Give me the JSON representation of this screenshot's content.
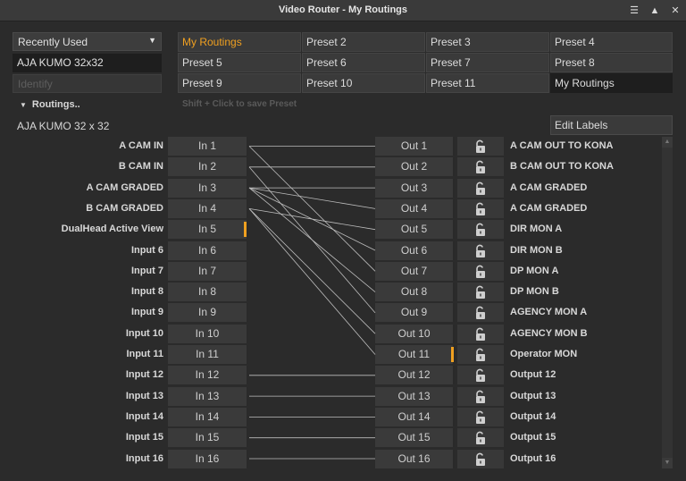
{
  "window": {
    "title": "Video Router - My Routings"
  },
  "recent": {
    "label": "Recently Used"
  },
  "device": {
    "name": "AJA KUMO 32x32"
  },
  "identify": {
    "label": "Identify"
  },
  "routings": {
    "toggle_label": "Routings..",
    "router_name": "AJA KUMO 32 x 32"
  },
  "presets": {
    "hint": "Shift + Click to save Preset",
    "rows": [
      [
        "My Routings",
        "Preset 2",
        "Preset 3",
        "Preset 4"
      ],
      [
        "Preset 5",
        "Preset 6",
        "Preset 7",
        "Preset 8"
      ],
      [
        "Preset 9",
        "Preset 10",
        "Preset 11",
        "My Routings"
      ]
    ],
    "active_color": "#f0a020"
  },
  "edit_labels": {
    "label": "Edit Labels"
  },
  "inputs": [
    {
      "label": "A CAM IN",
      "button": "In 1"
    },
    {
      "label": "B CAM IN",
      "button": "In 2"
    },
    {
      "label": "A CAM GRADED",
      "button": "In 3"
    },
    {
      "label": "B CAM GRADED",
      "button": "In 4"
    },
    {
      "label": "DualHead Active View",
      "button": "In 5"
    },
    {
      "label": "Input 6",
      "button": "In 6"
    },
    {
      "label": "Input 7",
      "button": "In 7"
    },
    {
      "label": "Input 8",
      "button": "In 8"
    },
    {
      "label": "Input 9",
      "button": "In 9"
    },
    {
      "label": "Input 10",
      "button": "In 10"
    },
    {
      "label": "Input 11",
      "button": "In 11"
    },
    {
      "label": "Input 12",
      "button": "In 12"
    },
    {
      "label": "Input 13",
      "button": "In 13"
    },
    {
      "label": "Input 14",
      "button": "In 14"
    },
    {
      "label": "Input 15",
      "button": "In 15"
    },
    {
      "label": "Input 16",
      "button": "In 16"
    }
  ],
  "outputs": [
    {
      "button": "Out 1",
      "label": "A CAM OUT TO KONA"
    },
    {
      "button": "Out 2",
      "label": "B CAM OUT TO KONA"
    },
    {
      "button": "Out 3",
      "label": "A CAM GRADED"
    },
    {
      "button": "Out 4",
      "label": "A CAM GRADED"
    },
    {
      "button": "Out 5",
      "label": "DIR MON A"
    },
    {
      "button": "Out 6",
      "label": "DIR MON B"
    },
    {
      "button": "Out 7",
      "label": "DP MON A"
    },
    {
      "button": "Out 8",
      "label": "DP MON B"
    },
    {
      "button": "Out 9",
      "label": "AGENCY MON A"
    },
    {
      "button": "Out 10",
      "label": "AGENCY MON B"
    },
    {
      "button": "Out 11",
      "label": "Operator MON"
    },
    {
      "button": "Out 12",
      "label": "Output 12"
    },
    {
      "button": "Out 13",
      "label": "Output 13"
    },
    {
      "button": "Out 14",
      "label": "Output 14"
    },
    {
      "button": "Out 15",
      "label": "Output 15"
    },
    {
      "button": "Out 16",
      "label": "Output 16"
    }
  ],
  "routes": [
    [
      1,
      1
    ],
    [
      1,
      7
    ],
    [
      2,
      2
    ],
    [
      2,
      9
    ],
    [
      3,
      3
    ],
    [
      3,
      4
    ],
    [
      3,
      6
    ],
    [
      3,
      8
    ],
    [
      4,
      5
    ],
    [
      4,
      10
    ],
    [
      4,
      11
    ],
    [
      12,
      12
    ],
    [
      13,
      13
    ],
    [
      14,
      14
    ],
    [
      15,
      15
    ],
    [
      16,
      16
    ]
  ],
  "selected": {
    "input": 5,
    "output": 11
  },
  "lock_icon": "unlocked-padlock-icon"
}
